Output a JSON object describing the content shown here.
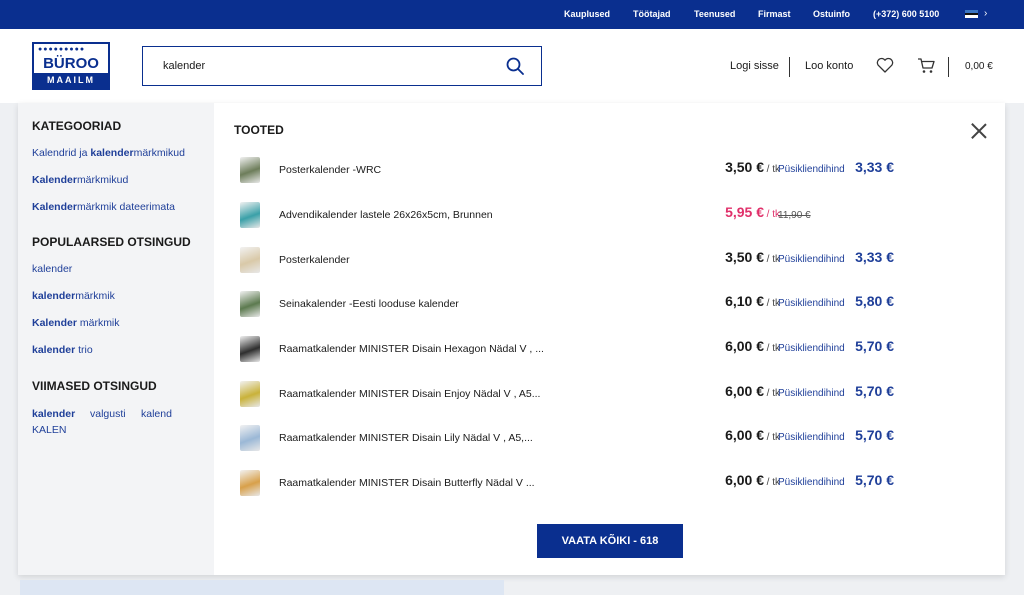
{
  "topbar": {
    "links": [
      "Kauplused",
      "Töötajad",
      "Teenused",
      "Firmast",
      "Ostuinfo",
      "(+372) 600 5100"
    ]
  },
  "logo": {
    "line1": "BÜROO",
    "line2": "MAAILM"
  },
  "search": {
    "value": "kalender",
    "icon": "search-icon"
  },
  "header": {
    "login": "Logi sisse",
    "register": "Loo konto",
    "cart_total": "0,00 €"
  },
  "sidebar": {
    "categories_title": "KATEGOORIAD",
    "categories": [
      {
        "pre": "Kalendrid ja ",
        "bold": "kalender",
        "post": "märkmikud"
      },
      {
        "pre": "",
        "bold": "Kalender",
        "post": "märkmikud"
      },
      {
        "pre": "",
        "bold": "Kalender",
        "post": "märkmik dateerimata"
      }
    ],
    "popular_title": "POPULAARSED OTSINGUD",
    "popular": [
      {
        "bold": "kalender",
        "post": ""
      },
      {
        "bold": "kalender",
        "post": "märkmik"
      },
      {
        "bold": "Kalender",
        "post": " märkmik"
      },
      {
        "bold": "kalender",
        "post": " trio"
      }
    ],
    "recent_title": "VIIMASED OTSINGUD",
    "recent": [
      "kalender",
      "valgusti",
      "kalend",
      "KALEN"
    ]
  },
  "products": {
    "title": "TOOTED",
    "unit": "/ tk",
    "loyalty_label": "Püsikliendihind",
    "items": [
      {
        "name": "Posterkalender -WRC",
        "price": "3,50 €",
        "loyalty": "3,33 €",
        "thumb": "#6d7d5a"
      },
      {
        "name": "Advendikalender lastele 26x26x5cm, Brunnen",
        "price": "5,95 €",
        "old": "11,90 €",
        "sale": true,
        "thumb": "#3aa0a8"
      },
      {
        "name": "Posterkalender",
        "price": "3,50 €",
        "loyalty": "3,33 €",
        "thumb": "#d9c9a8"
      },
      {
        "name": "Seinakalender -Eesti looduse kalender",
        "price": "6,10 €",
        "loyalty": "5,80 €",
        "thumb": "#5c7a4f"
      },
      {
        "name": "Raamatkalender MINISTER Disain Hexagon Nädal V , ...",
        "price": "6,00 €",
        "loyalty": "5,70 €",
        "thumb": "#2e2e2e"
      },
      {
        "name": "Raamatkalender MINISTER Disain Enjoy Nädal V , A5...",
        "price": "6,00 €",
        "loyalty": "5,70 €",
        "thumb": "#c9b23a"
      },
      {
        "name": "Raamatkalender MINISTER Disain Lily Nädal V , A5,...",
        "price": "6,00 €",
        "loyalty": "5,70 €",
        "thumb": "#9bb8d6"
      },
      {
        "name": "Raamatkalender MINISTER Disain Butterfly Nädal V ...",
        "price": "6,00 €",
        "loyalty": "5,70 €",
        "thumb": "#d8a04a"
      }
    ],
    "see_all": "VAATA KÕIKI - 618"
  },
  "colors": {
    "brand": "#0a2f8f",
    "link": "#1f3f99",
    "sale": "#e0306a"
  }
}
